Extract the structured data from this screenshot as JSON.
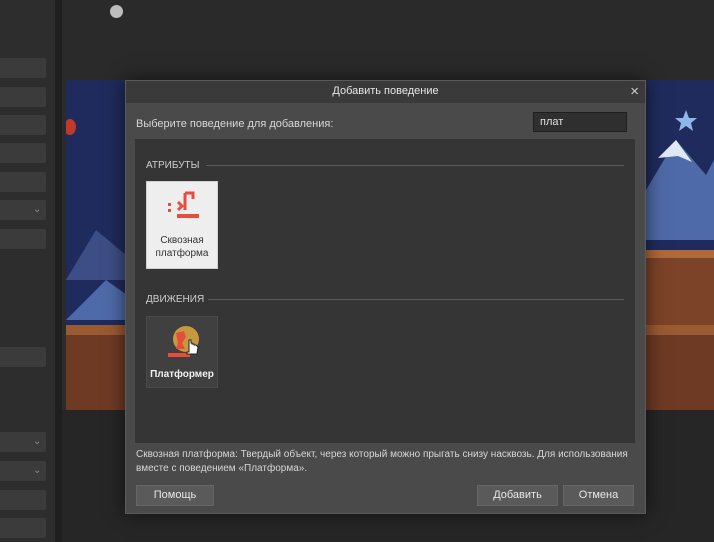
{
  "dialog": {
    "title": "Добавить поведение",
    "close_icon": "close-icon",
    "prompt": "Выберите поведение для добавления:",
    "search": {
      "value": "плат",
      "placeholder": ""
    },
    "categories": [
      {
        "label": "АТРИБУТЫ",
        "items": [
          {
            "label": "Сквозная платформа",
            "icon": "jump-thru-icon",
            "selected": true
          }
        ]
      },
      {
        "label": "ДВИЖЕНИЯ",
        "items": [
          {
            "label": "Платформер",
            "icon": "platformer-icon",
            "selected": false
          }
        ]
      }
    ],
    "description": "Сквозная платформа: Твердый объект, через который можно прыгать снизу насквозь. Для использования вместе с поведением «Платформа».",
    "buttons": {
      "help": "Помощь",
      "add": "Добавить",
      "cancel": "Отмена"
    }
  },
  "colors": {
    "accent_red": "#e74c3c",
    "dialog_bg": "#4a4a4a",
    "list_bg": "#353535",
    "selected_tile_bg": "#eeeeee"
  }
}
